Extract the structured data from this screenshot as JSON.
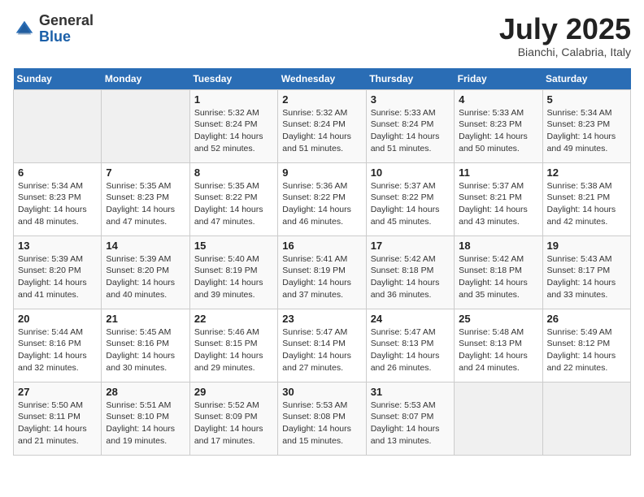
{
  "header": {
    "logo": {
      "general": "General",
      "blue": "Blue"
    },
    "title": "July 2025",
    "subtitle": "Bianchi, Calabria, Italy"
  },
  "weekdays": [
    "Sunday",
    "Monday",
    "Tuesday",
    "Wednesday",
    "Thursday",
    "Friday",
    "Saturday"
  ],
  "weeks": [
    [
      {
        "day": "",
        "sunrise": "",
        "sunset": "",
        "daylight": ""
      },
      {
        "day": "",
        "sunrise": "",
        "sunset": "",
        "daylight": ""
      },
      {
        "day": "1",
        "sunrise": "Sunrise: 5:32 AM",
        "sunset": "Sunset: 8:24 PM",
        "daylight": "Daylight: 14 hours and 52 minutes."
      },
      {
        "day": "2",
        "sunrise": "Sunrise: 5:32 AM",
        "sunset": "Sunset: 8:24 PM",
        "daylight": "Daylight: 14 hours and 51 minutes."
      },
      {
        "day": "3",
        "sunrise": "Sunrise: 5:33 AM",
        "sunset": "Sunset: 8:24 PM",
        "daylight": "Daylight: 14 hours and 51 minutes."
      },
      {
        "day": "4",
        "sunrise": "Sunrise: 5:33 AM",
        "sunset": "Sunset: 8:23 PM",
        "daylight": "Daylight: 14 hours and 50 minutes."
      },
      {
        "day": "5",
        "sunrise": "Sunrise: 5:34 AM",
        "sunset": "Sunset: 8:23 PM",
        "daylight": "Daylight: 14 hours and 49 minutes."
      }
    ],
    [
      {
        "day": "6",
        "sunrise": "Sunrise: 5:34 AM",
        "sunset": "Sunset: 8:23 PM",
        "daylight": "Daylight: 14 hours and 48 minutes."
      },
      {
        "day": "7",
        "sunrise": "Sunrise: 5:35 AM",
        "sunset": "Sunset: 8:23 PM",
        "daylight": "Daylight: 14 hours and 47 minutes."
      },
      {
        "day": "8",
        "sunrise": "Sunrise: 5:35 AM",
        "sunset": "Sunset: 8:22 PM",
        "daylight": "Daylight: 14 hours and 47 minutes."
      },
      {
        "day": "9",
        "sunrise": "Sunrise: 5:36 AM",
        "sunset": "Sunset: 8:22 PM",
        "daylight": "Daylight: 14 hours and 46 minutes."
      },
      {
        "day": "10",
        "sunrise": "Sunrise: 5:37 AM",
        "sunset": "Sunset: 8:22 PM",
        "daylight": "Daylight: 14 hours and 45 minutes."
      },
      {
        "day": "11",
        "sunrise": "Sunrise: 5:37 AM",
        "sunset": "Sunset: 8:21 PM",
        "daylight": "Daylight: 14 hours and 43 minutes."
      },
      {
        "day": "12",
        "sunrise": "Sunrise: 5:38 AM",
        "sunset": "Sunset: 8:21 PM",
        "daylight": "Daylight: 14 hours and 42 minutes."
      }
    ],
    [
      {
        "day": "13",
        "sunrise": "Sunrise: 5:39 AM",
        "sunset": "Sunset: 8:20 PM",
        "daylight": "Daylight: 14 hours and 41 minutes."
      },
      {
        "day": "14",
        "sunrise": "Sunrise: 5:39 AM",
        "sunset": "Sunset: 8:20 PM",
        "daylight": "Daylight: 14 hours and 40 minutes."
      },
      {
        "day": "15",
        "sunrise": "Sunrise: 5:40 AM",
        "sunset": "Sunset: 8:19 PM",
        "daylight": "Daylight: 14 hours and 39 minutes."
      },
      {
        "day": "16",
        "sunrise": "Sunrise: 5:41 AM",
        "sunset": "Sunset: 8:19 PM",
        "daylight": "Daylight: 14 hours and 37 minutes."
      },
      {
        "day": "17",
        "sunrise": "Sunrise: 5:42 AM",
        "sunset": "Sunset: 8:18 PM",
        "daylight": "Daylight: 14 hours and 36 minutes."
      },
      {
        "day": "18",
        "sunrise": "Sunrise: 5:42 AM",
        "sunset": "Sunset: 8:18 PM",
        "daylight": "Daylight: 14 hours and 35 minutes."
      },
      {
        "day": "19",
        "sunrise": "Sunrise: 5:43 AM",
        "sunset": "Sunset: 8:17 PM",
        "daylight": "Daylight: 14 hours and 33 minutes."
      }
    ],
    [
      {
        "day": "20",
        "sunrise": "Sunrise: 5:44 AM",
        "sunset": "Sunset: 8:16 PM",
        "daylight": "Daylight: 14 hours and 32 minutes."
      },
      {
        "day": "21",
        "sunrise": "Sunrise: 5:45 AM",
        "sunset": "Sunset: 8:16 PM",
        "daylight": "Daylight: 14 hours and 30 minutes."
      },
      {
        "day": "22",
        "sunrise": "Sunrise: 5:46 AM",
        "sunset": "Sunset: 8:15 PM",
        "daylight": "Daylight: 14 hours and 29 minutes."
      },
      {
        "day": "23",
        "sunrise": "Sunrise: 5:47 AM",
        "sunset": "Sunset: 8:14 PM",
        "daylight": "Daylight: 14 hours and 27 minutes."
      },
      {
        "day": "24",
        "sunrise": "Sunrise: 5:47 AM",
        "sunset": "Sunset: 8:13 PM",
        "daylight": "Daylight: 14 hours and 26 minutes."
      },
      {
        "day": "25",
        "sunrise": "Sunrise: 5:48 AM",
        "sunset": "Sunset: 8:13 PM",
        "daylight": "Daylight: 14 hours and 24 minutes."
      },
      {
        "day": "26",
        "sunrise": "Sunrise: 5:49 AM",
        "sunset": "Sunset: 8:12 PM",
        "daylight": "Daylight: 14 hours and 22 minutes."
      }
    ],
    [
      {
        "day": "27",
        "sunrise": "Sunrise: 5:50 AM",
        "sunset": "Sunset: 8:11 PM",
        "daylight": "Daylight: 14 hours and 21 minutes."
      },
      {
        "day": "28",
        "sunrise": "Sunrise: 5:51 AM",
        "sunset": "Sunset: 8:10 PM",
        "daylight": "Daylight: 14 hours and 19 minutes."
      },
      {
        "day": "29",
        "sunrise": "Sunrise: 5:52 AM",
        "sunset": "Sunset: 8:09 PM",
        "daylight": "Daylight: 14 hours and 17 minutes."
      },
      {
        "day": "30",
        "sunrise": "Sunrise: 5:53 AM",
        "sunset": "Sunset: 8:08 PM",
        "daylight": "Daylight: 14 hours and 15 minutes."
      },
      {
        "day": "31",
        "sunrise": "Sunrise: 5:53 AM",
        "sunset": "Sunset: 8:07 PM",
        "daylight": "Daylight: 14 hours and 13 minutes."
      },
      {
        "day": "",
        "sunrise": "",
        "sunset": "",
        "daylight": ""
      },
      {
        "day": "",
        "sunrise": "",
        "sunset": "",
        "daylight": ""
      }
    ]
  ]
}
